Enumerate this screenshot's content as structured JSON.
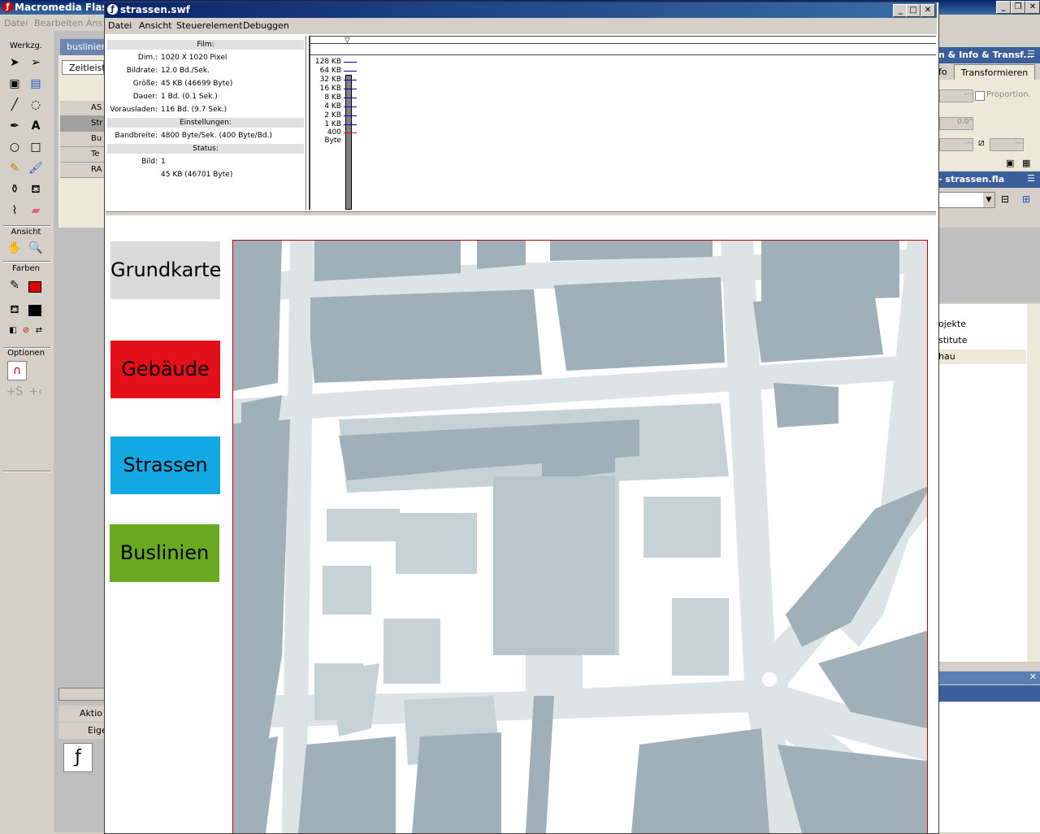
{
  "main_window": {
    "title": "Macromedia Flash",
    "menu": [
      "Datei",
      "Bearbeiten",
      "Ans"
    ]
  },
  "tools": {
    "label": "Werkzg.",
    "ansicht": "Ansicht",
    "farben": "Farben",
    "optionen": "Optionen",
    "stroke_color": "#e00000",
    "fill_color": "#000000"
  },
  "editor": {
    "tab": "buslinien",
    "timeline": "Zeitleist",
    "layers": [
      "AS",
      "Str",
      "Bu",
      "Te",
      "RA"
    ],
    "panels": [
      "Aktio",
      "Eige"
    ]
  },
  "swf_window": {
    "title": "strassen.swf",
    "menu": [
      "Datei",
      "Ansicht",
      "Steuerelement",
      "Debuggen"
    ]
  },
  "stats": {
    "film_header": "Film:",
    "rows": [
      {
        "label": "Dim.:",
        "value": "1020 X 1020 Pixel"
      },
      {
        "label": "Bildrate:",
        "value": "12.0 Bd./Sek."
      },
      {
        "label": "Größe:",
        "value": "45 KB (46699 Byte)"
      },
      {
        "label": "Dauer:",
        "value": "1 Bd. (0.1 Sek.)"
      },
      {
        "label": "Vorausladen:",
        "value": "116 Bd. (9.7 Sek.)"
      }
    ],
    "settings_header": "Einstellungen:",
    "bandwidth_label": "Bandbreite:",
    "bandwidth_value": "4800 Byte/Sek. (400 Byte/Bd.)",
    "status_header": "Status:",
    "frame_label": "Bild:",
    "frame_value": "1",
    "frame_size": "45 KB (46701 Byte)"
  },
  "graph": {
    "labels": [
      "128 KB",
      "64 KB",
      "32 KB",
      "16 KB",
      "8 KB",
      "4 KB",
      "2 KB",
      "1 KB",
      "400 Byte"
    ]
  },
  "stage": {
    "buttons": [
      {
        "label": "Grundkarte",
        "color": "#d9d9d9"
      },
      {
        "label": "Gebäude",
        "color": "#e3101a"
      },
      {
        "label": "Strassen",
        "color": "#12a8e3"
      },
      {
        "label": "Buslinien",
        "color": "#6aaa22"
      }
    ]
  },
  "right_panel": {
    "header1": "n & Info & Transf...",
    "tab_fo": "fo",
    "tab_transform": "Transformieren",
    "proportion": "Proportion.",
    "field1": "---",
    "angle": "0.0°",
    "field2": "---",
    "field3": "---",
    "library_header": "- strassen.fla",
    "lib_items": [
      "ojekte",
      "stitute",
      "hau"
    ]
  },
  "colors": {
    "map_building": "#9fb0b8",
    "map_block": "#c7d2d6",
    "map_street": "#dde4e6"
  }
}
